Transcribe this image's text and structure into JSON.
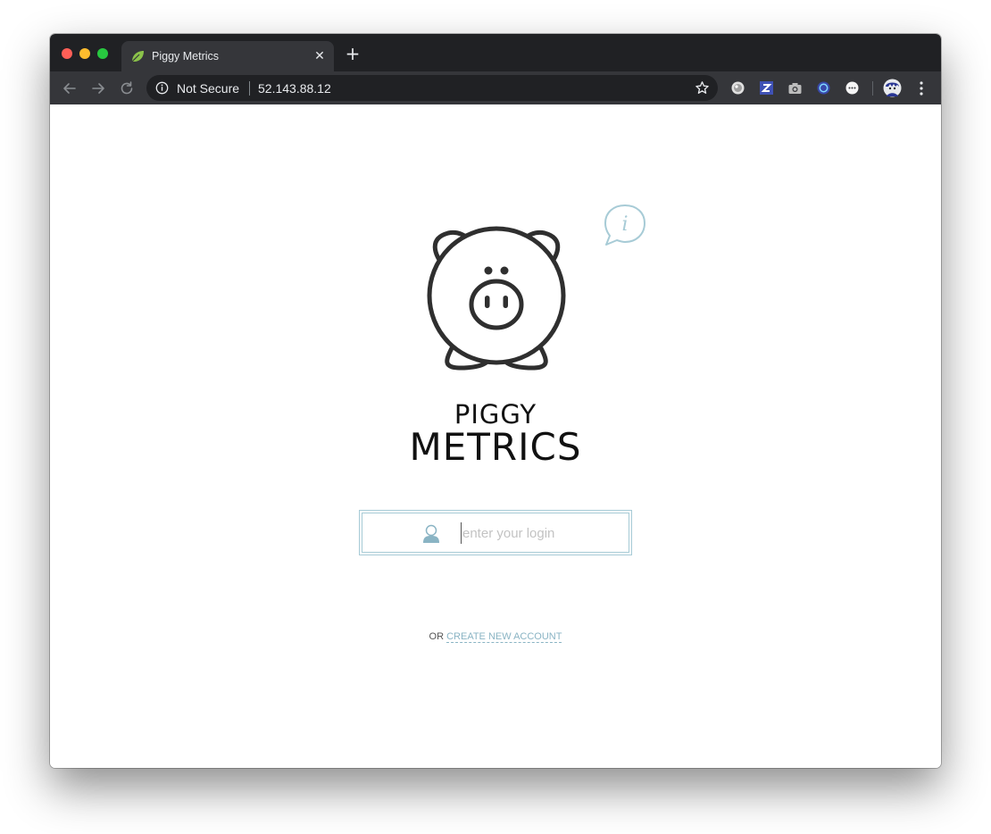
{
  "browser": {
    "tab_title": "Piggy Metrics",
    "tab_close": "✕",
    "new_tab": "+",
    "security_label": "Not Secure",
    "url": "52.143.88.12",
    "menu": "⋮"
  },
  "icons": {
    "favicon": "leaf-icon",
    "back": "arrow-left-icon",
    "forward": "arrow-right-icon",
    "reload": "reload-icon",
    "info": "info-circle-icon",
    "bookmark": "star-icon",
    "extensions": [
      "circle-extension-icon",
      "z-extension-icon",
      "camera-extension-icon",
      "ring-extension-icon",
      "bubble-extension-icon"
    ],
    "profile": "avatar-icon",
    "pig": "piggy-bank-icon",
    "help": "info-bubble-icon",
    "user": "user-icon"
  },
  "brand": {
    "line1": "PIGGY",
    "line2": "METRICS"
  },
  "login": {
    "placeholder": "enter your login",
    "value": ""
  },
  "signup": {
    "prefix": "OR",
    "link": "CREATE NEW ACCOUNT"
  },
  "colors": {
    "accent": "#8ab4c4",
    "input_border": "#a7cbd6",
    "chrome_dark": "#202124",
    "chrome_toolbar": "#35363a",
    "brand_text": "#111111"
  }
}
